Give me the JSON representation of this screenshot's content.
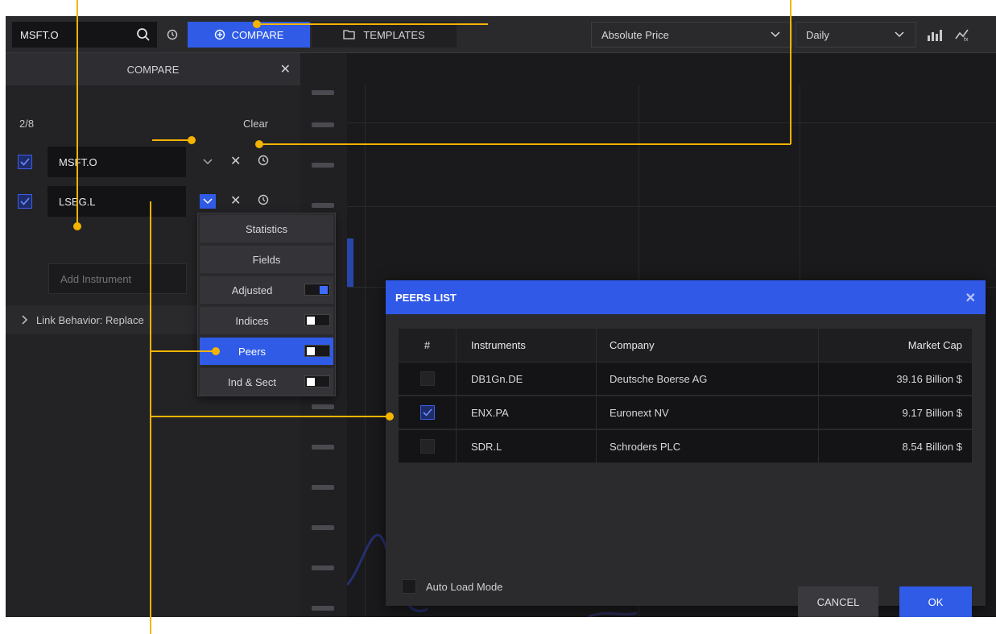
{
  "toolbar": {
    "ric_value": "MSFT.O",
    "compare_label": "COMPARE",
    "templates_label": "TEMPLATES",
    "price_type": "Absolute Price",
    "frequency": "Daily"
  },
  "panel": {
    "title": "COMPARE",
    "count": "2/8",
    "clear_label": "Clear",
    "instruments": [
      {
        "ric": "MSFT.O",
        "checked": true
      },
      {
        "ric": "LSEG.L",
        "checked": true
      }
    ],
    "add_placeholder": "Add Instrument",
    "link_behavior": "Link Behavior: Replace"
  },
  "menu": {
    "items": [
      {
        "label": "Statistics"
      },
      {
        "label": "Fields"
      },
      {
        "label": "Adjusted",
        "toggle": true
      },
      {
        "label": "Indices",
        "toggle": false
      },
      {
        "label": "Peers",
        "toggle": false,
        "selected": true
      },
      {
        "label": "Ind & Sect",
        "toggle": false
      }
    ]
  },
  "dialog": {
    "title": "PEERS LIST",
    "columns": [
      "#",
      "Instruments",
      "Company",
      "Market Cap"
    ],
    "rows": [
      {
        "checked": false,
        "ric": "DB1Gn.DE",
        "company": "Deutsche Boerse AG",
        "cap": "39.16 Billion $"
      },
      {
        "checked": true,
        "ric": "ENX.PA",
        "company": "Euronext NV",
        "cap": "9.17 Billion $"
      },
      {
        "checked": false,
        "ric": "SDR.L",
        "company": "Schroders PLC",
        "cap": "8.54 Billion $"
      }
    ],
    "auto_load": "Auto Load Mode",
    "cancel_label": "CANCEL",
    "ok_label": "OK"
  },
  "colors": {
    "accent": "#2f5be7",
    "callout": "#f5b400",
    "background": "#1c1c1e"
  }
}
